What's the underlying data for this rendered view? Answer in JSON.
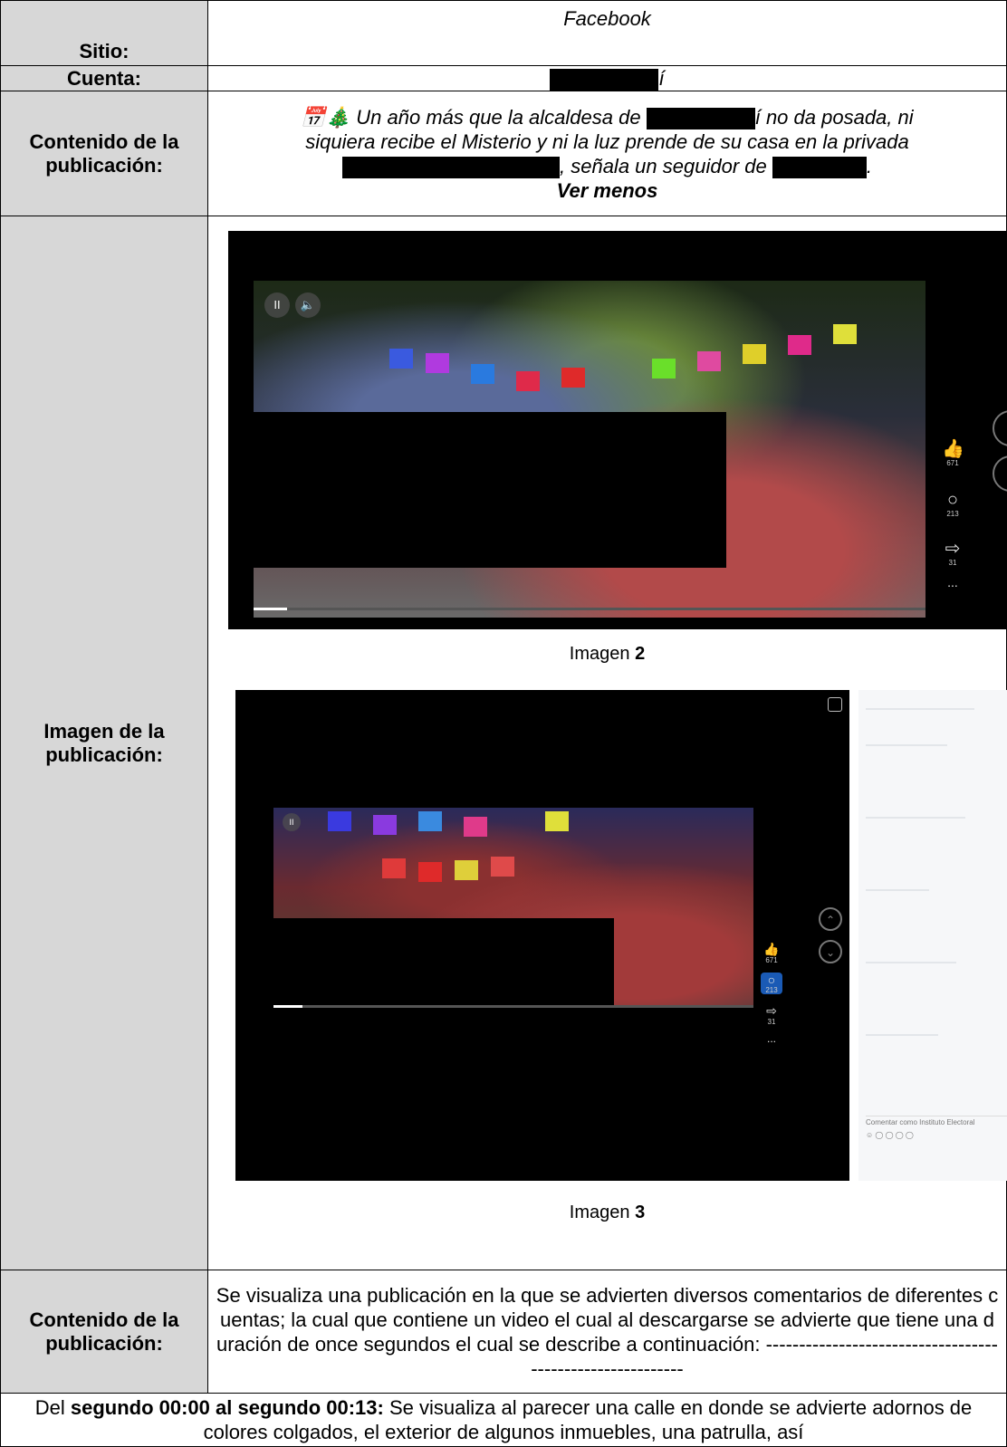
{
  "rows": {
    "site": {
      "label": "Sitio:",
      "value": "Facebook"
    },
    "account": {
      "label": "Cuenta:",
      "suffix": "í"
    },
    "content": {
      "label": "Contenido de la publicación:",
      "emoji": "📅🎄",
      "line1_a": "Un año más que la alcaldesa de",
      "line1_b": "í no da posada, ni",
      "line2": "siquiera recibe el Misterio y ni la luz prende de su casa en la privada",
      "line3_a": ", señala un seguidor de",
      "line3_b": ".",
      "more": "Ver menos"
    },
    "image": {
      "label": "Imagen de la publicación:",
      "shot1": {
        "likes": "671",
        "comments": "213",
        "shares": "31",
        "more": "...",
        "pause": "II",
        "volume": "🔈"
      },
      "caption1_text": "Imagen",
      "caption1_num": "2",
      "shot2": {
        "likes": "671",
        "comments": "213",
        "shares": "31",
        "more": "...",
        "comment_placeholder": "Comentar como Instituto Electoral"
      },
      "caption2_text": "Imagen",
      "caption2_num": "3"
    },
    "description": {
      "label": "Contenido de la publicación:",
      "text": "Se visualiza una publicación en la que se advierten diversos comentarios de diferentes cuentas; la cual que contiene un video el cual al descargarse se advierte que tiene una duración de once segundos el cual se describe a continuación: ----------------------------------------------------------"
    },
    "segment": {
      "prefix": "Del",
      "bold": "segundo 00:00 al segundo 00:13:",
      "text": "Se visualiza al parecer una calle en donde se advierte adornos de colores colgados, el exterior de algunos inmuebles, una patrulla, así"
    }
  }
}
